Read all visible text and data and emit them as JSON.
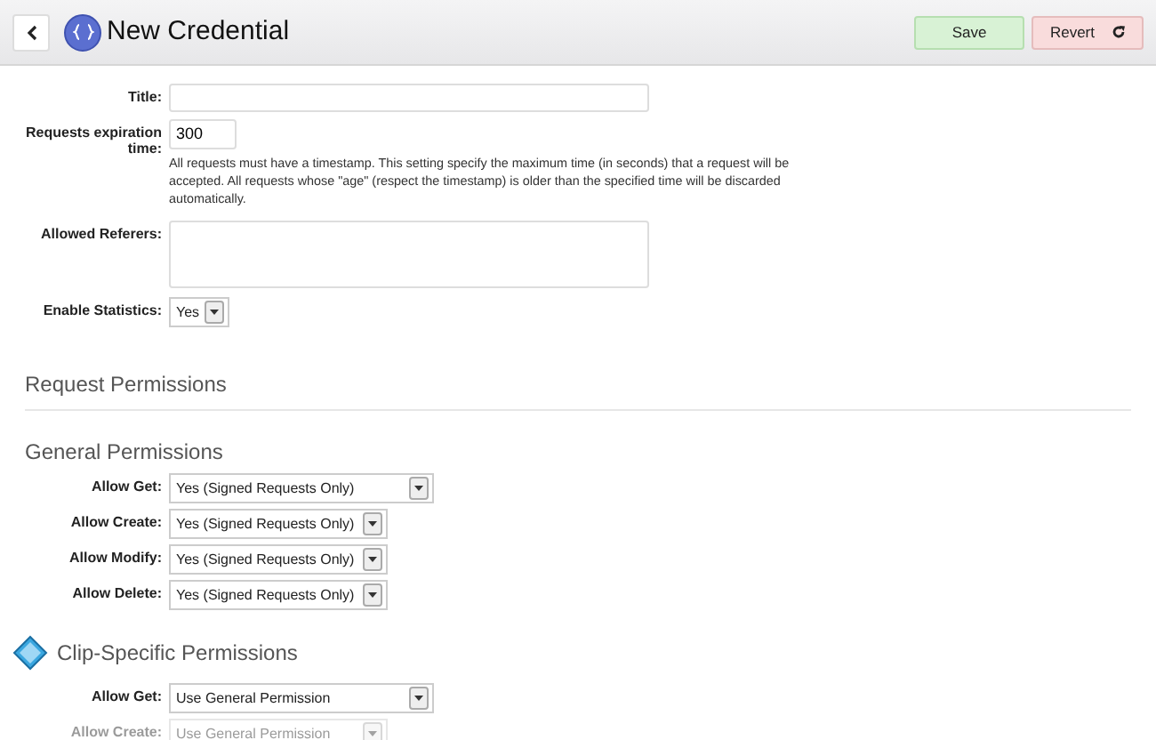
{
  "header": {
    "title": "New Credential",
    "save": "Save",
    "revert": "Revert"
  },
  "form": [
    {
      "kind": "text",
      "label": "Title:"
    },
    {
      "kind": "number",
      "label": "Requests expiration time:",
      "value": "300",
      "help": "All requests must have a timestamp. This setting specify the maximum time (in seconds) that a request will be accepted. All requests whose \"age\" (respect the timestamp) is older than the specified time will be discarded automatically."
    },
    {
      "kind": "textarea",
      "label": "Allowed Referers:"
    },
    {
      "kind": "select",
      "label": "Enable Statistics:",
      "value": "Yes"
    }
  ],
  "request_permissions": {
    "title": "Request Permissions"
  },
  "general_permissions": {
    "title": "General Permissions",
    "rows": [
      {
        "label": "Allow Get:",
        "value": "Yes (Signed Requests Only)",
        "wide": true
      },
      {
        "label": "Allow Create:",
        "value": "Yes (Signed Requests Only)",
        "wide": false
      },
      {
        "label": "Allow Modify:",
        "value": "Yes (Signed Requests Only)",
        "wide": false
      },
      {
        "label": "Allow Delete:",
        "value": "Yes (Signed Requests Only)",
        "wide": false
      }
    ]
  },
  "clip_permissions": {
    "title": "Clip-Specific Permissions",
    "rows": [
      {
        "label": "Allow Get:",
        "value": "Use General Permission",
        "wide": true
      },
      {
        "label": "Allow Create:",
        "value": "Use General Permission",
        "wide": false
      }
    ]
  }
}
